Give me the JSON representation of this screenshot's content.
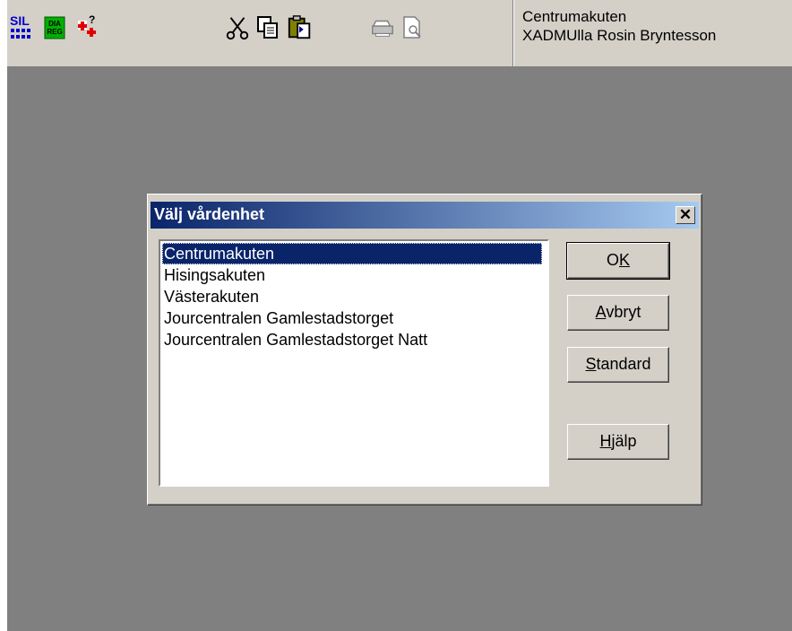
{
  "user_panel": {
    "unit": "Centrumakuten",
    "user": "XADMUlla Rosin Bryntesson"
  },
  "toolbar": {
    "icons": [
      "sil-icon",
      "dia-reg-icon",
      "medical-help-icon",
      "cut-icon",
      "copy-icon",
      "paste-icon",
      "print-icon",
      "print-preview-icon"
    ],
    "sil_text": "SIL",
    "dia_text_top": "DIA",
    "dia_text_bottom": "REG"
  },
  "dialog": {
    "title": "Välj vårdenhet",
    "close_label": "✕",
    "units": [
      "Centrumakuten",
      "Hisingsakuten",
      "Västerakuten",
      "Jourcentralen Gamlestadstorget",
      "Jourcentralen Gamlestadstorget Natt"
    ],
    "selected_index": 0,
    "buttons": {
      "ok": {
        "before": "O",
        "accel": "K",
        "after": ""
      },
      "cancel": {
        "before": "",
        "accel": "A",
        "after": "vbryt"
      },
      "standard": {
        "before": "",
        "accel": "S",
        "after": "tandard"
      },
      "help": {
        "before": "",
        "accel": "H",
        "after": "jälp"
      }
    }
  },
  "colors": {
    "title_start": "#0a246a",
    "title_end": "#a6caf0",
    "workspace": "#808080",
    "face": "#d4d0c8",
    "selection": "#0a246a"
  }
}
